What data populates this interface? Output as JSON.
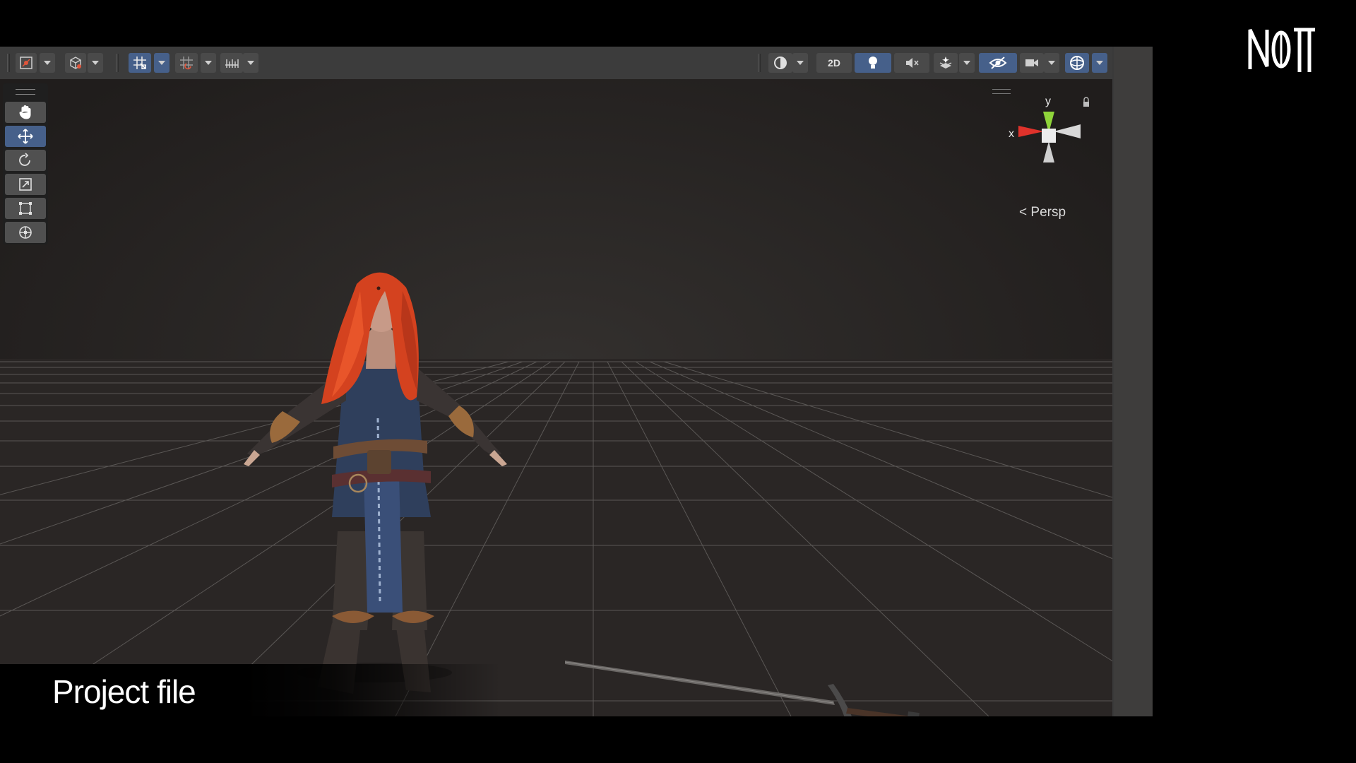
{
  "toolbar": {
    "left_tools": [
      "gizmos-icon",
      "draw-mode-icon",
      "grid-snap-icon",
      "snap-increment-icon",
      "ruler-icon"
    ],
    "view_2d_label": "2D",
    "right_tools": [
      "shading-mode-icon",
      "lighting-icon",
      "audio-icon",
      "effects-icon",
      "scene-visibility-icon",
      "camera-icon",
      "gizmo-toggle-icon"
    ]
  },
  "tools_panel": {
    "items": [
      "hand-tool-icon",
      "move-tool-icon",
      "rotate-tool-icon",
      "scale-tool-icon",
      "rect-tool-icon",
      "transform-tool-icon"
    ],
    "active": "move-tool-icon"
  },
  "gizmo": {
    "x_label": "x",
    "y_label": "y",
    "projection_label": "Persp"
  },
  "caption": {
    "text": "Project file"
  },
  "colors": {
    "accent": "#46608a",
    "x_axis": "#e0322b",
    "y_axis": "#8fd43a",
    "z_axis": "#d0d0d0"
  }
}
